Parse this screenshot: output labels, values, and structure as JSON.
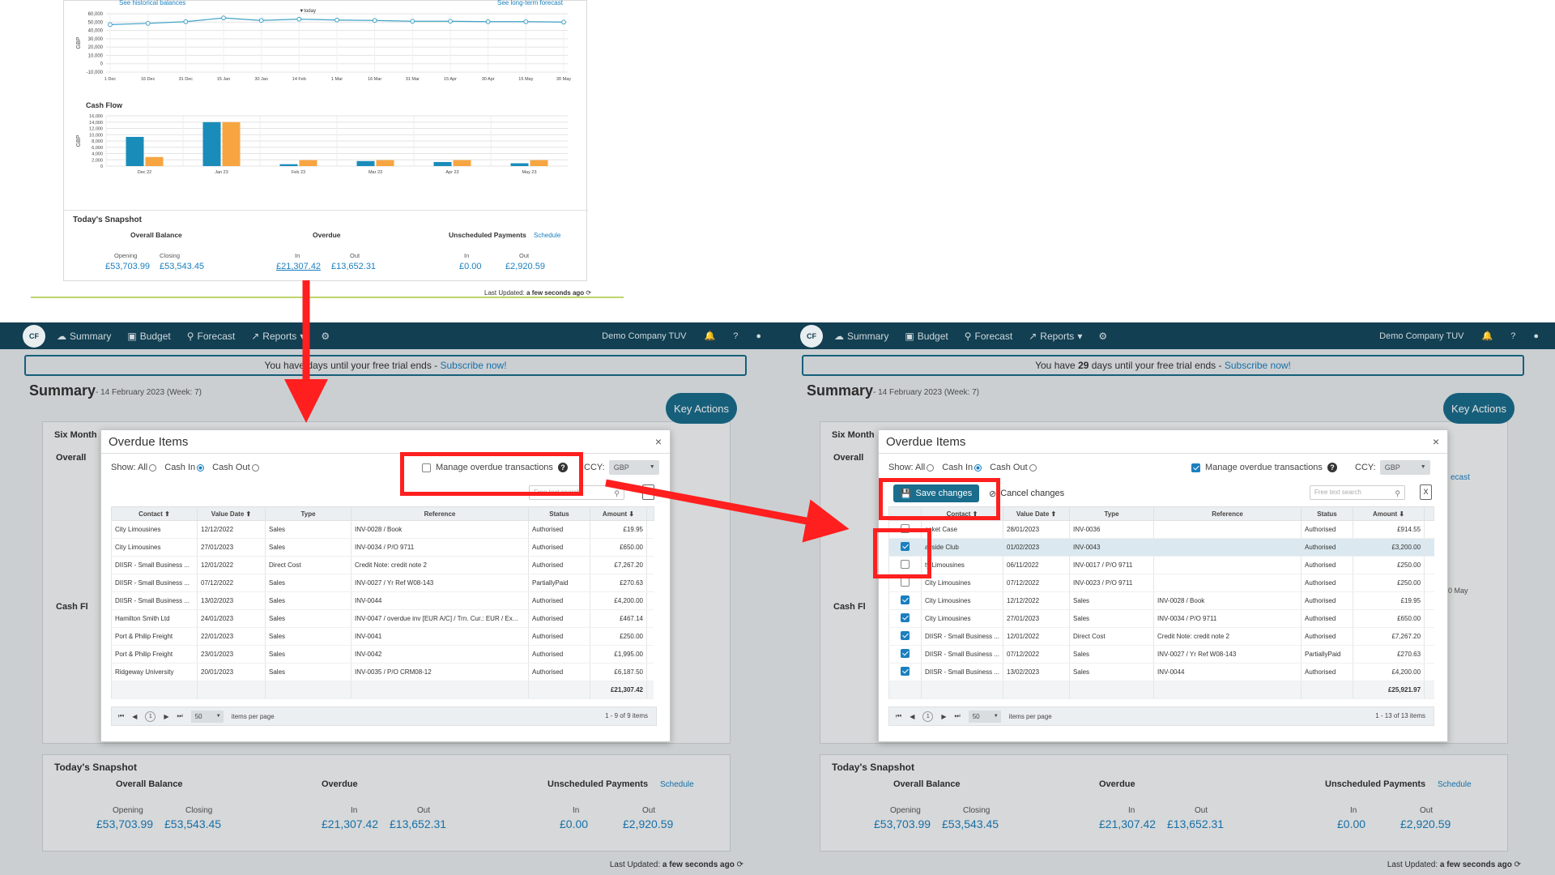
{
  "top": {
    "links": {
      "historical": "See historical balances",
      "forecast": "See long-term forecast"
    },
    "balance_chart": {
      "today_label": "▼today",
      "ylabel": "GBP",
      "yticks": [
        "60,000",
        "50,000",
        "40,000",
        "30,000",
        "20,000",
        "10,000",
        "0",
        "-10,000"
      ],
      "xticks": [
        "1 Dec",
        "16 Dec",
        "31 Dec",
        "15 Jan",
        "30 Jan",
        "14 Feb",
        "1 Mar",
        "16 Mar",
        "31 Mar",
        "15 Apr",
        "30 Apr",
        "15 May",
        "30 May"
      ]
    },
    "cashflow": {
      "title": "Cash Flow",
      "ylabel": "GBP",
      "yticks": [
        "16,000",
        "14,000",
        "12,000",
        "10,000",
        "8,000",
        "6,000",
        "4,000",
        "2,000",
        "0"
      ]
    },
    "snapshot": {
      "title": "Today's Snapshot",
      "overall": "Overall Balance",
      "overdue": "Overdue",
      "unscheduled": "Unscheduled Payments",
      "schedule_link": "Schedule",
      "opening_label": "Opening",
      "closing_label": "Closing",
      "in_label": "In",
      "out_label": "Out",
      "opening": "£53,703.99",
      "closing": "£53,543.45",
      "overdue_in": "£21,307.42",
      "overdue_out": "£13,652.31",
      "unsched_in": "£0.00",
      "unsched_out": "£2,920.59"
    },
    "last_updated_label": "Last Updated:",
    "last_updated_value": "a few seconds ago"
  },
  "chart_data": [
    {
      "type": "line",
      "title": "",
      "xlabel": "",
      "ylabel": "GBP",
      "ylim": [
        -10000,
        60000
      ],
      "x": [
        "1 Dec",
        "16 Dec",
        "31 Dec",
        "15 Jan",
        "30 Jan",
        "14 Feb",
        "1 Mar",
        "16 Mar",
        "31 Mar",
        "15 Apr",
        "30 Apr",
        "15 May",
        "30 May"
      ],
      "series": [
        {
          "values": [
            47000,
            48500,
            50500,
            55000,
            52000,
            53543,
            52500,
            52000,
            51000,
            51000,
            50500,
            50500,
            50000
          ]
        }
      ]
    },
    {
      "type": "bar",
      "title": "Cash Flow",
      "ylabel": "GBP",
      "ylim": [
        0,
        16000
      ],
      "categories": [
        "Dec 22",
        "Jan 23",
        "Feb 23",
        "Mar 23",
        "Apr 23",
        "May 23"
      ],
      "series": [
        {
          "color": "#1a8cba",
          "values": [
            9300,
            14000,
            600,
            1600,
            1300,
            900
          ]
        },
        {
          "color": "#f7a540",
          "values": [
            2900,
            14000,
            1900,
            1900,
            1900,
            1900
          ]
        }
      ]
    }
  ],
  "app": {
    "nav": [
      "Summary",
      "Budget",
      "Forecast",
      "Reports"
    ],
    "logo": "CF",
    "company": "Demo Company TUV",
    "trial_pre": "You have ",
    "trial_days_left": "",
    "trial_days_right": "29",
    "trial_post": " days until your free trial ends",
    "trial_sep": " - ",
    "subscribe": "Subscribe now!",
    "title": "Summary",
    "date": "- 14 February 2023  (Week: 7)",
    "key_actions": "Key Actions",
    "six_month": "Six Month",
    "overall": "Overall",
    "cash_fl": "Cash Fl",
    "gbp": "GBP",
    "forecast_link": "ecast",
    "may_tick": "30 May",
    "snapshot": {
      "title": "Today's Snapshot",
      "overall": "Overall Balance",
      "overdue": "Overdue",
      "unscheduled": "Unscheduled Payments",
      "schedule_link": "Schedule",
      "opening_label": "Opening",
      "closing_label": "Closing",
      "in_label": "In",
      "out_label": "Out",
      "opening": "£53,703.99",
      "closing": "£53,543.45",
      "overdue_in": "£21,307.42",
      "overdue_out": "£13,652.31",
      "unsched_in": "£0.00",
      "unsched_out": "£2,920.59"
    },
    "last_updated_label": "Last Updated:",
    "last_updated_value": "a few seconds ago"
  },
  "modal_left": {
    "title": "Overdue Items",
    "show": "Show: All",
    "cash_in": "Cash In",
    "cash_out": "Cash Out",
    "manage": "Manage overdue transactions",
    "ccy_label": "CCY:",
    "ccy_value": "GBP",
    "search_placeholder": "Free text search",
    "columns": [
      "Contact",
      "Value Date",
      "Type",
      "Reference",
      "Status",
      "Amount"
    ],
    "rows": [
      [
        "City Limousines",
        "12/12/2022",
        "Sales",
        "INV-0028 / Book",
        "Authorised",
        "£19.95"
      ],
      [
        "City Limousines",
        "27/01/2023",
        "Sales",
        "INV-0034 / P/O 9711",
        "Authorised",
        "£650.00"
      ],
      [
        "DIISR - Small Business ...",
        "12/01/2022",
        "Direct Cost",
        "Credit Note: credit note 2",
        "Authorised",
        "£7,267.20"
      ],
      [
        "DIISR - Small Business ...",
        "07/12/2022",
        "Sales",
        "INV-0027 / Yr Ref W08-143",
        "PartiallyPaid",
        "£270.63"
      ],
      [
        "DIISR - Small Business ...",
        "13/02/2023",
        "Sales",
        "INV-0044",
        "Authorised",
        "£4,200.00"
      ],
      [
        "Hamilton Smith Ltd",
        "24/01/2023",
        "Sales",
        "INV-0047 / overdue inv [EUR A/C] / Trn. Cur.: EUR / Ex...",
        "Authorised",
        "£467.14"
      ],
      [
        "Port & Philip Freight",
        "22/01/2023",
        "Sales",
        "INV-0041",
        "Authorised",
        "£250.00"
      ],
      [
        "Port & Philip Freight",
        "23/01/2023",
        "Sales",
        "INV-0042",
        "Authorised",
        "£1,995.00"
      ],
      [
        "Ridgeway University",
        "20/01/2023",
        "Sales",
        "INV-0035 / P/O CRM08-12",
        "Authorised",
        "£6,187.50"
      ]
    ],
    "total": "£21,307.42",
    "page": "1",
    "per_page": "50",
    "per_page_label": "items per page",
    "pager_info": "1 - 9 of 9 items"
  },
  "modal_right": {
    "title": "Overdue Items",
    "show": "Show: All",
    "cash_in": "Cash In",
    "cash_out": "Cash Out",
    "manage": "Manage overdue transactions",
    "ccy_label": "CCY:",
    "ccy_value": "GBP",
    "save": "Save changes",
    "cancel": "Cancel changes",
    "search_placeholder": "Free text search",
    "columns": [
      "",
      "Contact",
      "Value Date",
      "Type",
      "Reference",
      "Status",
      "Amount"
    ],
    "rows": [
      [
        "",
        "asket Case",
        "28/01/2023",
        "INV-0036",
        "",
        "Authorised",
        "£914.55"
      ],
      [
        "",
        "ayside Club",
        "01/02/2023",
        "INV-0043",
        "",
        "Authorised",
        "£3,200.00"
      ],
      [
        "",
        "ty Limousines",
        "06/11/2022",
        "INV-0017 / P/O 9711",
        "",
        "Authorised",
        "£250.00"
      ],
      [
        "",
        "City Limousines",
        "07/12/2022",
        "INV-0023 / P/O 9711",
        "",
        "Authorised",
        "£250.00"
      ],
      [
        "",
        "City Limousines",
        "12/12/2022",
        "Sales",
        "INV-0028 / Book",
        "Authorised",
        "£19.95"
      ],
      [
        "",
        "City Limousines",
        "27/01/2023",
        "Sales",
        "INV-0034 / P/O 9711",
        "Authorised",
        "£650.00"
      ],
      [
        "",
        "DIISR - Small Business ...",
        "12/01/2022",
        "Direct Cost",
        "Credit Note: credit note 2",
        "Authorised",
        "£7,267.20"
      ],
      [
        "",
        "DIISR - Small Business ...",
        "07/12/2022",
        "Sales",
        "INV-0027 / Yr Ref W08-143",
        "PartiallyPaid",
        "£270.63"
      ],
      [
        "",
        "DIISR - Small Business ...",
        "13/02/2023",
        "Sales",
        "INV-0044",
        "Authorised",
        "£4,200.00"
      ]
    ],
    "checked": [
      false,
      true,
      false,
      false,
      true,
      true,
      true,
      true,
      true
    ],
    "total": "£25,921.97",
    "page": "1",
    "per_page": "50",
    "per_page_label": "items per page",
    "pager_info": "1 - 13 of 13 items"
  },
  "colors": {
    "annotation": "#ff1f1f",
    "navbar": "#123f52",
    "accent": "#1a6d8c",
    "link": "#1a7fbf"
  }
}
